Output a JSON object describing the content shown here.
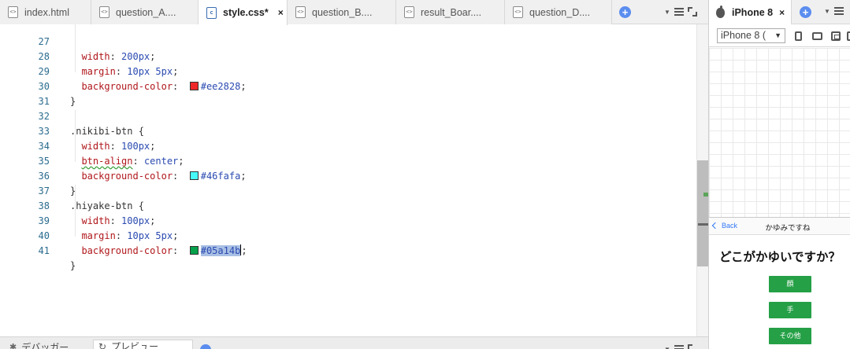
{
  "editor": {
    "tabs": [
      {
        "label": "index.html",
        "icon": "html-file-icon",
        "active": false
      },
      {
        "label": "question_A....",
        "icon": "html-file-icon",
        "active": false
      },
      {
        "label": "style.css*",
        "icon": "css-file-icon",
        "active": true,
        "close": "×"
      },
      {
        "label": "question_B....",
        "icon": "html-file-icon",
        "active": false
      },
      {
        "label": "result_Boar....",
        "icon": "html-file-icon",
        "active": false
      },
      {
        "label": "question_D....",
        "icon": "html-file-icon",
        "active": false
      }
    ],
    "lines": [
      {
        "n": "27",
        "indent": "  ",
        "prop": "width",
        "value": "200px"
      },
      {
        "n": "28",
        "indent": "  ",
        "prop": "margin",
        "value": "10px 5px"
      },
      {
        "n": "29",
        "indent": "  ",
        "prop": "background-color",
        "color": "#ee2828",
        "value": "#ee2828"
      },
      {
        "n": "30",
        "text": "}"
      },
      {
        "n": "31",
        "text": ""
      },
      {
        "n": "32",
        "text": ".nikibi-btn {"
      },
      {
        "n": "33",
        "indent": "  ",
        "prop": "width",
        "value": "100px"
      },
      {
        "n": "34",
        "indent": "  ",
        "prop": "btn-align",
        "value": "center"
      },
      {
        "n": "35",
        "indent": "  ",
        "prop": "background-color",
        "color": "#46fafa",
        "value": "#46fafa"
      },
      {
        "n": "36",
        "text": "}"
      },
      {
        "n": "37",
        "text": ".hiyake-btn {"
      },
      {
        "n": "38",
        "indent": "  ",
        "prop": "width",
        "value": "100px"
      },
      {
        "n": "39",
        "indent": "  ",
        "prop": "margin",
        "value": "10px 5px"
      },
      {
        "n": "40",
        "indent": "  ",
        "prop": "background-color",
        "color": "#05a14b",
        "value": "#05a14b"
      },
      {
        "n": "41",
        "text": "}"
      }
    ],
    "bottom_tabs": [
      {
        "label": "デバッガー",
        "icon": "bug-icon"
      },
      {
        "label": "プレビュー",
        "icon": "reload-icon"
      }
    ]
  },
  "preview": {
    "tab_label": "iPhone 8",
    "tab_close": "×",
    "device_select": "iPhone 8 (",
    "navbar": {
      "back": "Back",
      "title": "かゆみですね"
    },
    "question": "どこがかゆいですか？",
    "buttons": [
      "顔",
      "手",
      "その他"
    ],
    "button_color": "#25a046"
  },
  "colors": {
    "accent": "#5b8def",
    "property": "#b0171c",
    "value": "#2a4ab0",
    "line_number": "#2b6c8f"
  }
}
